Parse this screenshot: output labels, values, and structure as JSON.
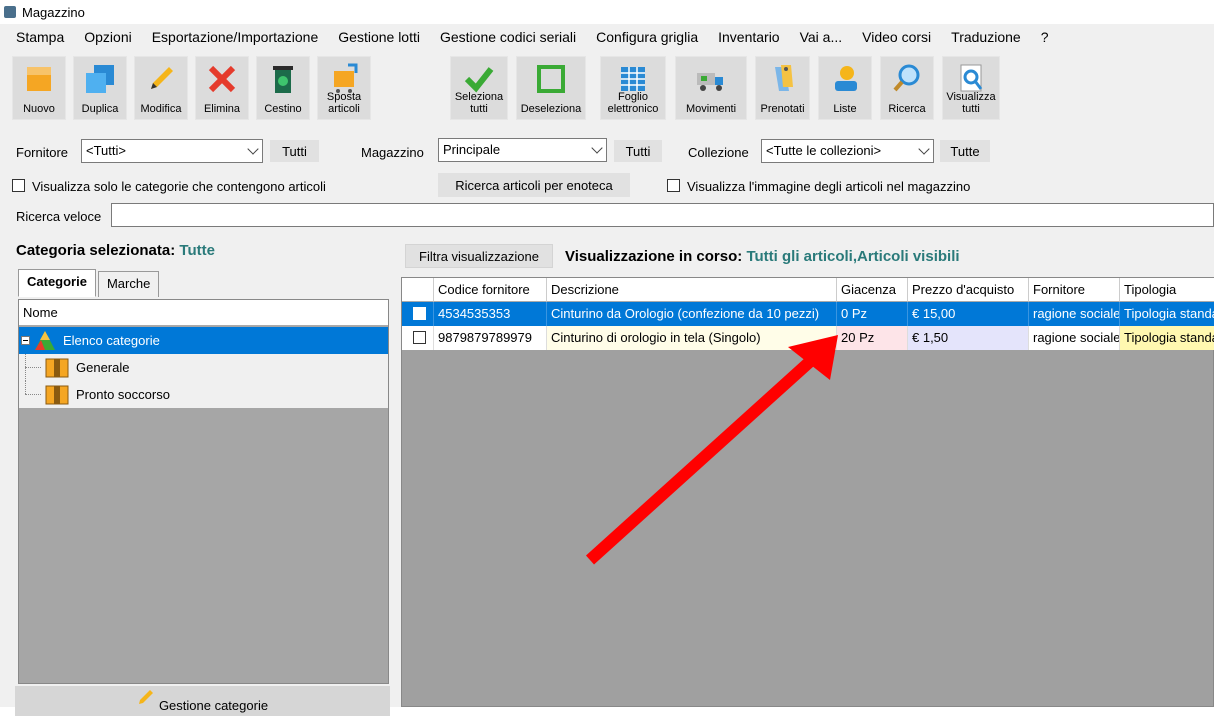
{
  "window": {
    "title": "Magazzino"
  },
  "menu": [
    "Stampa",
    "Opzioni",
    "Esportazione/Importazione",
    "Gestione lotti",
    "Gestione codici seriali",
    "Configura griglia",
    "Inventario",
    "Vai a...",
    "Video corsi",
    "Traduzione",
    "?"
  ],
  "toolbar": {
    "nuovo": "Nuovo",
    "duplica": "Duplica",
    "modifica": "Modifica",
    "elimina": "Elimina",
    "cestino": "Cestino",
    "sposta": "Sposta articoli",
    "seleziona": "Seleziona tutti",
    "deseleziona": "Deseleziona",
    "foglio": "Foglio elettronico",
    "movimenti": "Movimenti",
    "prenotati": "Prenotati",
    "liste": "Liste",
    "ricerca": "Ricerca",
    "visualizza": "Visualizza tutti"
  },
  "filters": {
    "fornitore_label": "Fornitore",
    "fornitore_value": "<Tutti>",
    "fornitore_tutti": "Tutti",
    "magazzino_label": "Magazzino",
    "magazzino_value": "Principale",
    "magazzino_tutti": "Tutti",
    "collezione_label": "Collezione",
    "collezione_value": "<Tutte le collezioni>",
    "collezione_tutte": "Tutte",
    "solo_categorie": "Visualizza solo le categorie che contengono articoli",
    "ricerca_enoteca": "Ricerca articoli per enoteca",
    "visualizza_immagine": "Visualizza l'immagine degli articoli nel magazzino",
    "ricerca_veloce_label": "Ricerca veloce"
  },
  "left": {
    "categoria_label": "Categoria selezionata:",
    "categoria_value": "Tutte",
    "tab_categorie": "Categorie",
    "tab_marche": "Marche",
    "col_nome": "Nome",
    "tree": [
      "Elenco categorie",
      "Generale",
      "Pronto soccorso"
    ],
    "gestione_categorie": "Gestione categorie"
  },
  "right": {
    "filtra": "Filtra visualizzazione",
    "vis_label": "Visualizzazione in corso:",
    "vis_value": "Tutti gli articoli,Articoli visibili",
    "columns": [
      "Codice fornitore",
      "Descrizione",
      "Giacenza",
      "Prezzo d'acquisto",
      "Fornitore",
      "Tipologia"
    ],
    "rows": [
      {
        "codice": "4534535353",
        "descrizione": "Cinturino da Orologio (confezione da 10 pezzi)",
        "giacenza": "0 Pz",
        "prezzo": "€ 15,00",
        "fornitore": "ragione sociale",
        "tipologia": "Tipologia standard"
      },
      {
        "codice": "9879879789979",
        "descrizione": "Cinturino di orologio in tela (Singolo)",
        "giacenza": "20 Pz",
        "prezzo": "€ 1,50",
        "fornitore": "ragione sociale",
        "tipologia": "Tipologia standard"
      }
    ]
  },
  "colors": {
    "selection": "#0078d7",
    "accent_teal": "#2a7a7a",
    "annotation_arrow": "#ff0000"
  }
}
